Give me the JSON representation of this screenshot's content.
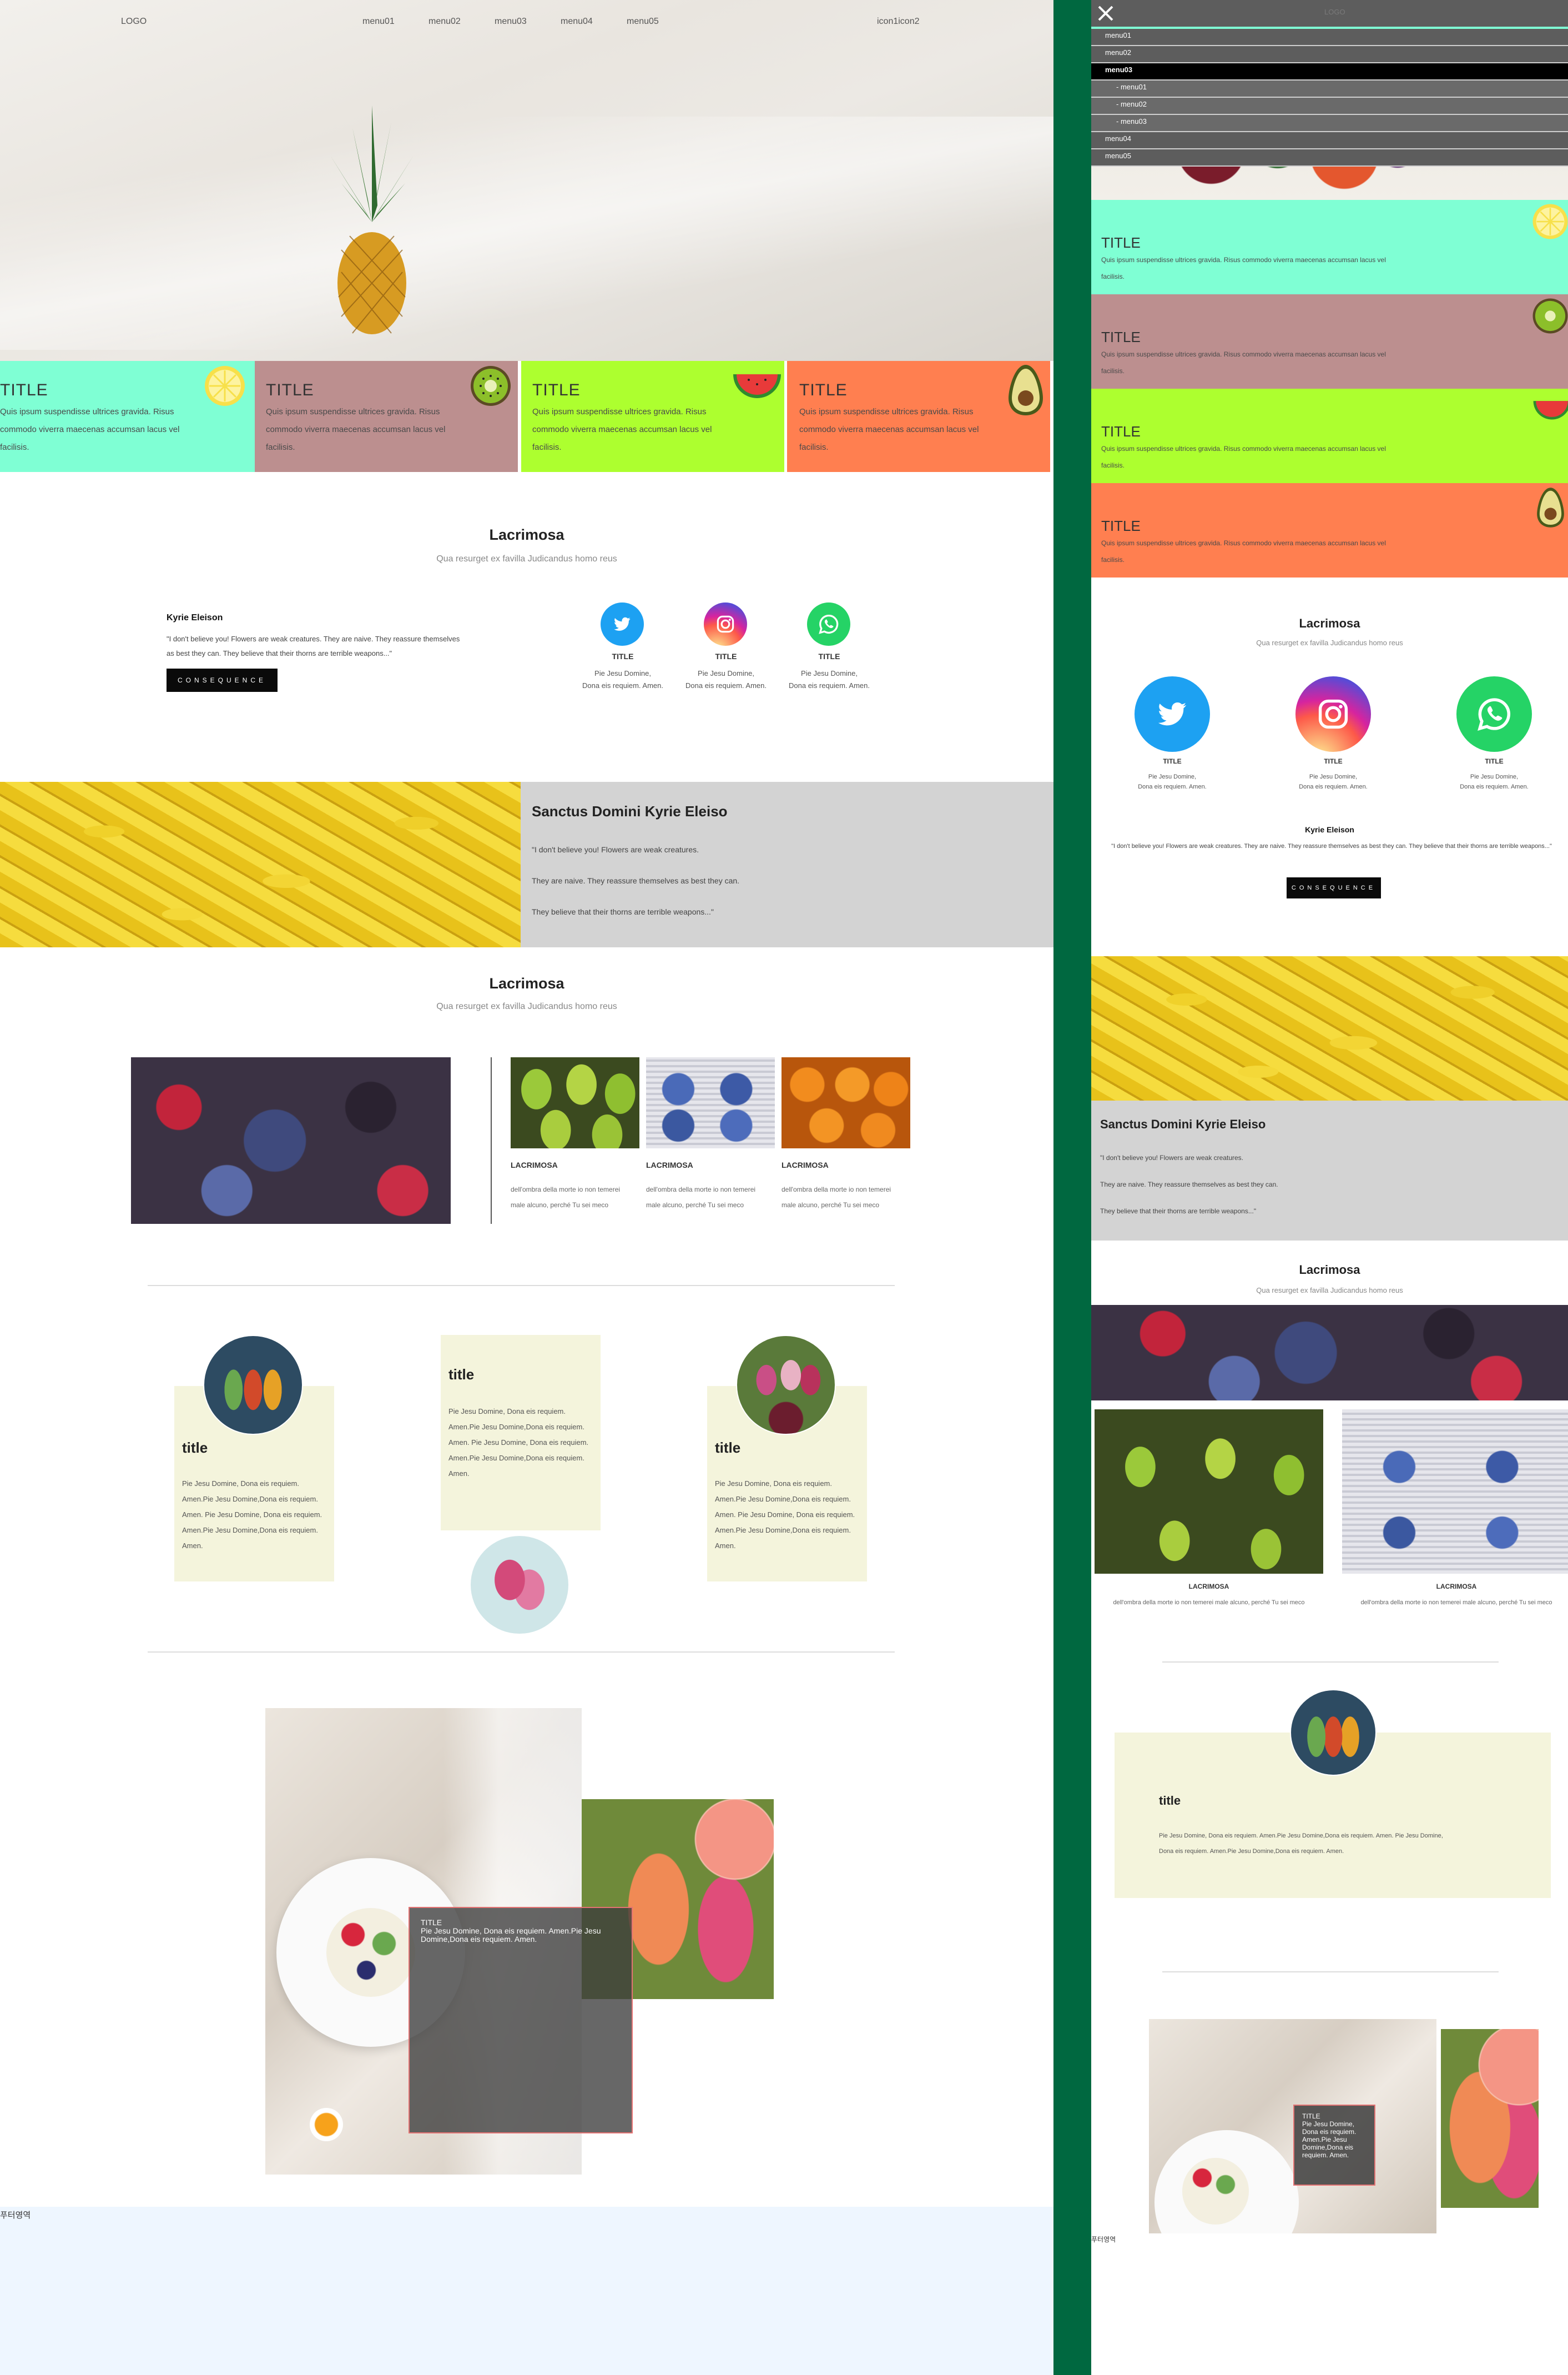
{
  "nav": {
    "logo": "LOGO",
    "menus": [
      "menu01",
      "menu02",
      "menu03",
      "menu04",
      "menu05"
    ],
    "icons": "icon1icon2"
  },
  "cards": [
    {
      "title": "TITLE",
      "text": "Quis ipsum suspendisse ultrices gravida. Risus commodo viverra maecenas accumsan lacus vel facilisis.",
      "color": "#7fffd4",
      "fruit": "lemon"
    },
    {
      "title": "TITLE",
      "text": "Quis ipsum suspendisse ultrices gravida. Risus commodo viverra maecenas accumsan lacus vel facilisis.",
      "color": "#bc8f8f",
      "fruit": "kiwi"
    },
    {
      "title": "TITLE",
      "text": "Quis ipsum suspendisse ultrices gravida. Risus commodo viverra maecenas accumsan lacus vel facilisis.",
      "color": "#adff2f",
      "fruit": "watermelon"
    },
    {
      "title": "TITLE",
      "text": "Quis ipsum suspendisse ultrices gravida. Risus commodo viverra maecenas accumsan lacus vel facilisis.",
      "color": "#ff7f50",
      "fruit": "avocado"
    }
  ],
  "section1": {
    "title": "Lacrimosa",
    "subtitle": "Qua resurget ex favilla Judicandus homo reus",
    "quote_author": "Kyrie Eleison",
    "quote": "\"I don't believe you! Flowers are weak creatures. They are naive. They reassure themselves as best they can. They believe that their thorns are terrible weapons...\"",
    "button": "CONSEQUENCE",
    "socials": [
      {
        "icon": "twitter-icon",
        "title": "TITLE",
        "text1": "Pie Jesu Domine,",
        "text2": "Dona eis requiem. Amen.",
        "color": "#1da1f2"
      },
      {
        "icon": "instagram-icon",
        "title": "TITLE",
        "text1": "Pie Jesu Domine,",
        "text2": "Dona eis requiem. Amen.",
        "color": "#c13584"
      },
      {
        "icon": "whatsapp-icon",
        "title": "TITLE",
        "text1": "Pie Jesu Domine,",
        "text2": "Dona eis requiem. Amen.",
        "color": "#25d366"
      }
    ]
  },
  "banana": {
    "title": "Sanctus Domini Kyrie Eleiso",
    "line1": "\"I don't believe you! Flowers are weak creatures.",
    "line2": "They are naive. They reassure themselves as best they can.",
    "line3": "They believe that their thorns are terrible weapons...\""
  },
  "section2": {
    "title": "Lacrimosa",
    "subtitle": "Qua resurget ex favilla Judicandus homo reus",
    "items": [
      {
        "label": "LACRIMOSA",
        "text": "dell'ombra della morte io non temerei male alcuno, perché Tu sei meco"
      },
      {
        "label": "LACRIMOSA",
        "text": "dell'ombra della morte io non temerei male alcuno, perché Tu sei meco"
      },
      {
        "label": "LACRIMOSA",
        "text": "dell'ombra della morte io non temerei male alcuno, perché Tu sei meco"
      }
    ]
  },
  "tcards": [
    {
      "title": "title",
      "text": "Pie Jesu Domine, Dona eis requiem. Amen.Pie Jesu Domine,Dona eis requiem. Amen. Pie Jesu Domine, Dona eis requiem. Amen.Pie Jesu Domine,Dona eis requiem. Amen."
    },
    {
      "title": "title",
      "text": "Pie Jesu Domine, Dona eis requiem. Amen.Pie Jesu Domine,Dona eis requiem. Amen. Pie Jesu Domine, Dona eis requiem. Amen.Pie Jesu Domine,Dona eis requiem. Amen."
    },
    {
      "title": "title",
      "text": "Pie Jesu Domine, Dona eis requiem. Amen.Pie Jesu Domine,Dona eis requiem. Amen. Pie Jesu Domine, Dona eis requiem. Amen.Pie Jesu Domine,Dona eis requiem. Amen."
    }
  ],
  "overlay": {
    "title": "TITLE",
    "text": "Pie Jesu Domine, Dona eis requiem. Amen.Pie Jesu Domine,Dona eis requiem. Amen."
  },
  "footer_label": "푸터영역",
  "mobile": {
    "logo": "LOGO",
    "menu": [
      "menu01",
      "menu02",
      "menu03",
      "- menu01",
      "- menu02",
      "- menu03",
      "menu04",
      "menu05"
    ],
    "tcard_text": "Pie Jesu Domine, Dona eis requiem. Amen.Pie Jesu Domine,Dona eis requiem. Amen. Pie Jesu Domine, Dona eis requiem. Amen.Pie Jesu Domine,Dona eis requiem. Amen.",
    "overlay_text": "Pie Jesu Domine, Dona eis requiem. Amen.Pie Jesu Domine,Dona eis requiem. Amen."
  }
}
